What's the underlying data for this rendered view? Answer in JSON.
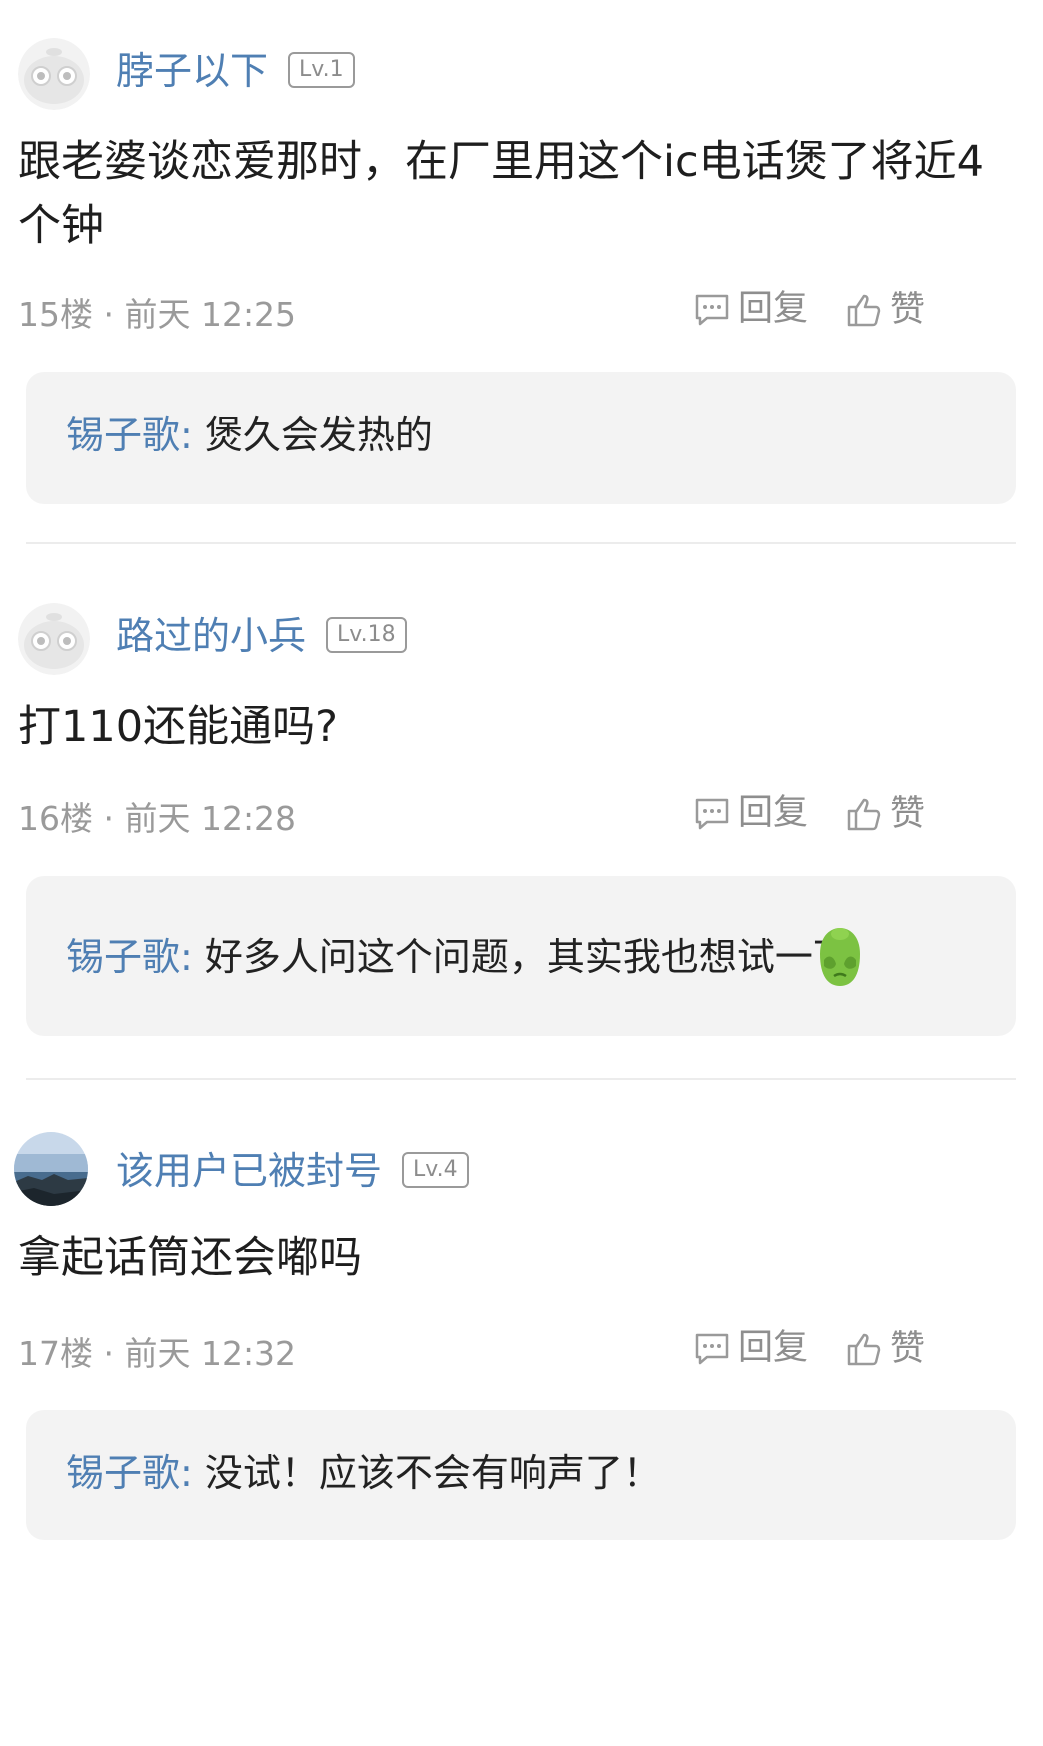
{
  "comments": [
    {
      "username": "脖子以下",
      "level": "Lv.1",
      "content": "跟老婆谈恋爱那时，在厂里用这个ic电话煲了将近4个钟",
      "floor_time": "15楼 · 前天 12:25",
      "reply_label": "回复",
      "like_label": "赞",
      "reply": {
        "author": "锡子歌",
        "separator": ":",
        "text": "煲久会发热的"
      }
    },
    {
      "username": "路过的小兵",
      "level": "Lv.18",
      "content": "打110还能通吗?",
      "floor_time": "16楼 · 前天 12:28",
      "reply_label": "回复",
      "like_label": "赞",
      "reply": {
        "author": "锡子歌",
        "separator": ":",
        "text": "好多人问这个问题，其实我也想试一下",
        "emoji": "covering-face-emoji"
      }
    },
    {
      "username": "该用户已被封号",
      "level": "Lv.4",
      "content": "拿起话筒还会嘟吗",
      "floor_time": "17楼 · 前天 12:32",
      "reply_label": "回复",
      "like_label": "赞",
      "reply": {
        "author": "锡子歌",
        "separator": ":",
        "text": "没试！应该不会有响声了！"
      }
    }
  ],
  "colors": {
    "username": "#4f7fb3",
    "meta": "#9a9a9a",
    "reply_bg": "#f3f3f3",
    "emoji_green": "#7cc242"
  },
  "icons": {
    "reply": "comment-bubble-icon",
    "like": "thumbs-up-icon",
    "default_avatar": "default-avatar-icon"
  }
}
